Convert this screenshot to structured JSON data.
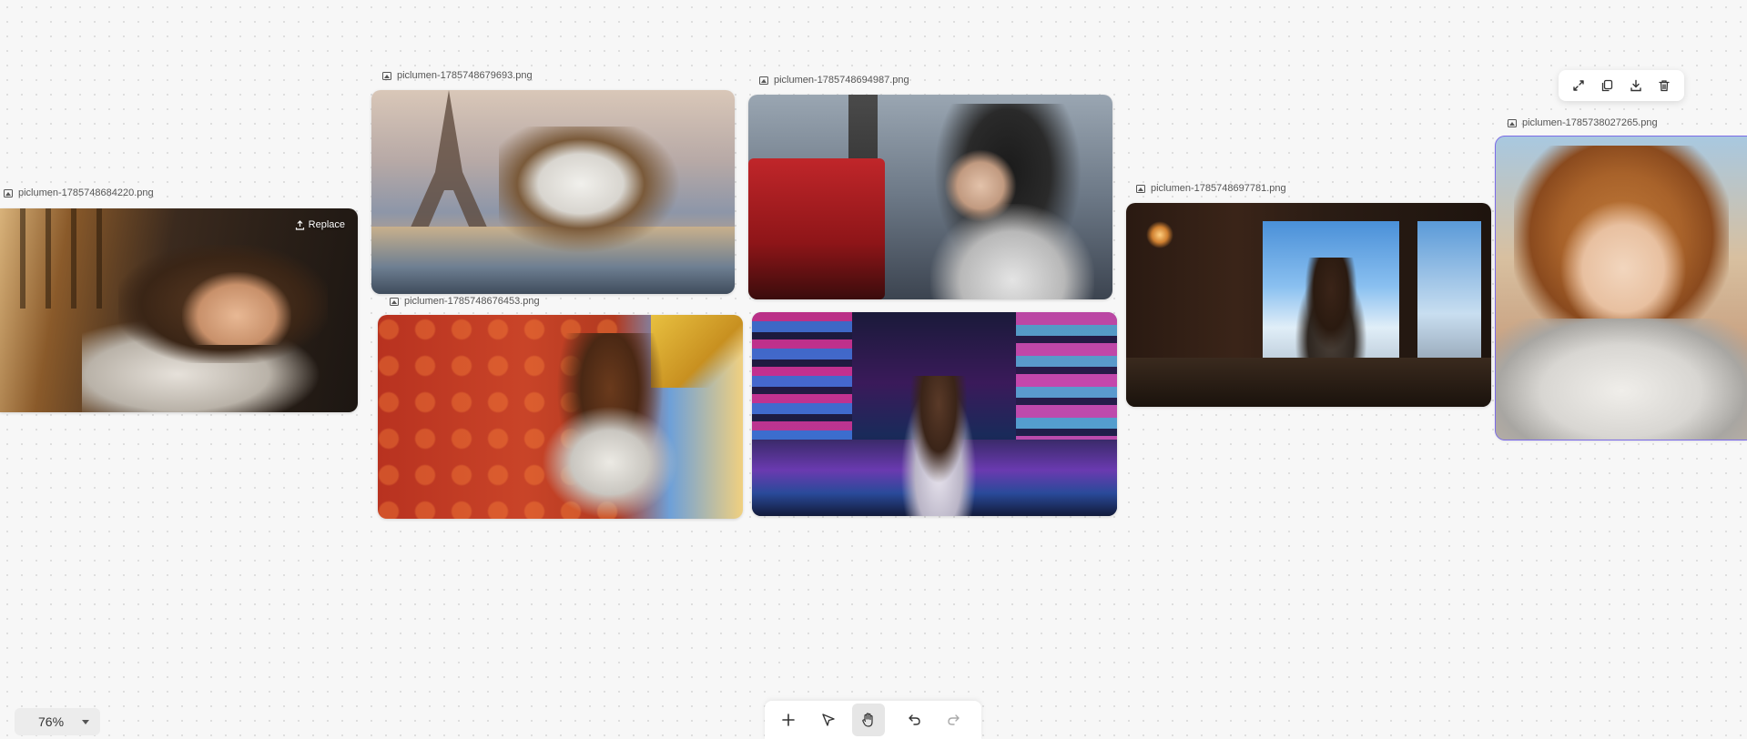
{
  "nodes": [
    {
      "label": "piclumen-1785748684220.png"
    },
    {
      "label": "piclumen-1785748679693.png"
    },
    {
      "label": "piclumen-1785748694987.png"
    },
    {
      "label": "piclumen-1785748676453.png"
    },
    {
      "label": "piclumen-1785748697781.png"
    },
    {
      "label": "piclumen-1785738027265.png"
    }
  ],
  "hover": {
    "replace_label": "Replace"
  },
  "zoom": {
    "value": "76%"
  },
  "icons": {
    "floating_toolbar": [
      "expand-icon",
      "duplicate-icon",
      "download-icon",
      "trash-icon"
    ],
    "bottom_toolbar": [
      "plus-icon",
      "select-pointer-icon",
      "hand-pan-icon",
      "undo-icon",
      "redo-icon"
    ]
  },
  "colors": {
    "selection": "#7b6be8",
    "canvas": "#f7f7f7"
  }
}
